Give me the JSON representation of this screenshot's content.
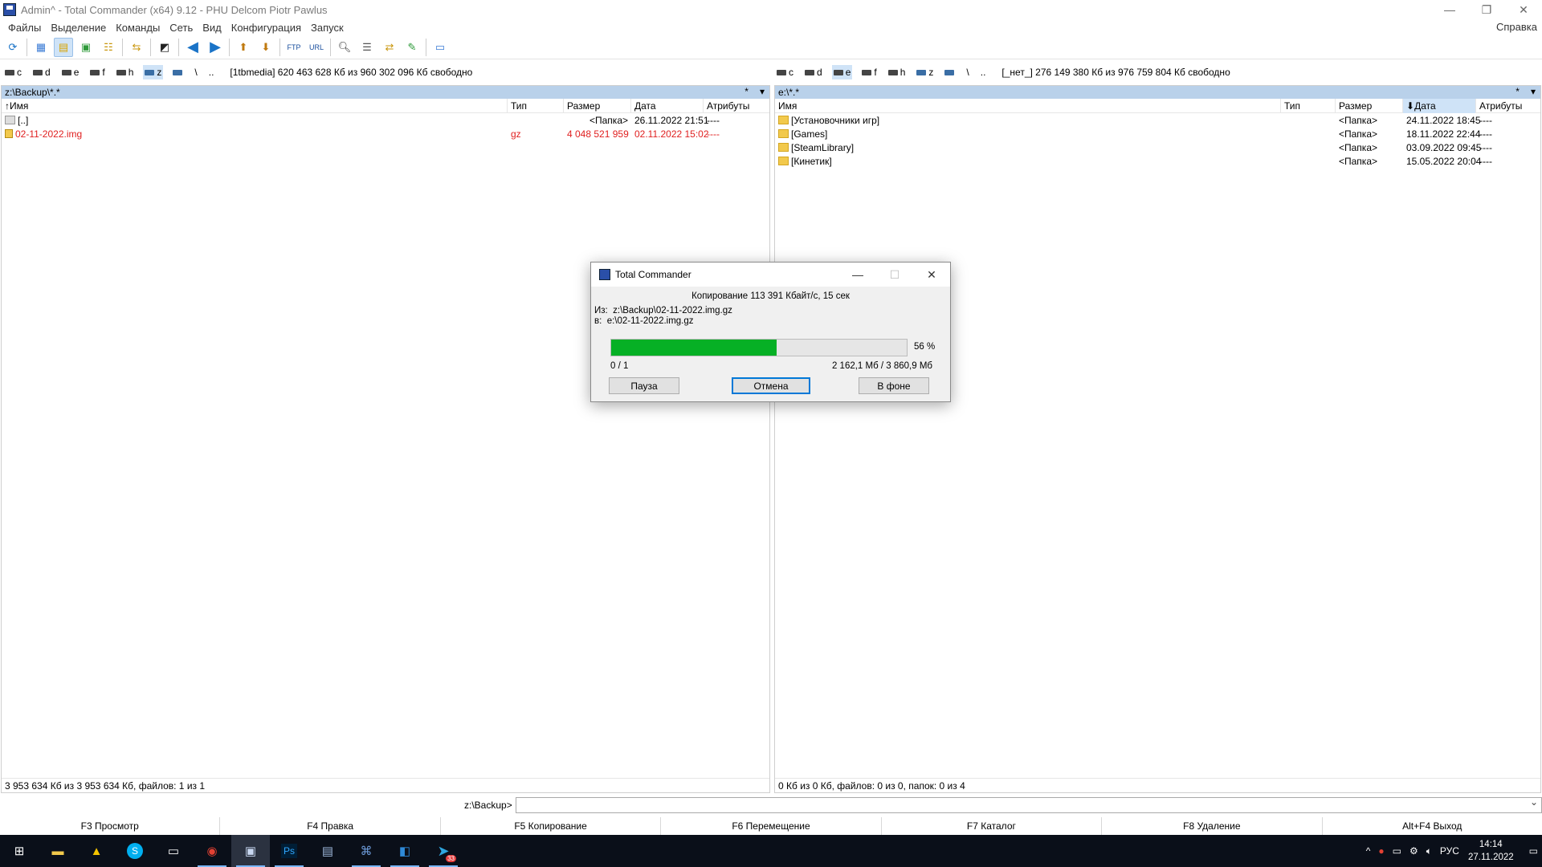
{
  "window": {
    "title": "Admin^ - Total Commander (x64) 9.12 - PHU Delcom Piotr Pawlus",
    "controls": [
      "—",
      "❐",
      "✕"
    ]
  },
  "menu": {
    "items": [
      "Файлы",
      "Выделение",
      "Команды",
      "Сеть",
      "Вид",
      "Конфигурация",
      "Запуск"
    ],
    "help": "Справка"
  },
  "toolbar": {
    "buttons": [
      "refresh-icon",
      "brief-view-icon",
      "tree-view-icon",
      "thumbnails-icon",
      "tree-panel-icon",
      "compare-dirs-icon",
      "invert-icon",
      "back-icon",
      "forward-icon",
      "pack-icon",
      "unpack-icon",
      "ftp-icon",
      "url-icon",
      "search-icon",
      "multi-rename-icon",
      "sync-dirs-icon",
      "notepad-icon",
      "copy-names-icon"
    ],
    "ftp_label": "FTP",
    "url_label": "URL"
  },
  "left": {
    "drives": [
      "c",
      "d",
      "e",
      "f",
      "h",
      "z"
    ],
    "active_drive": "z",
    "nav_root": "\\",
    "nav_up": "..",
    "drive_info": "[1tbmedia]  620 463 628 Кб из 960 302 096 Кб свободно",
    "path": "z:\\Backup\\*.*",
    "path_star": "*",
    "path_arrow": "▾",
    "columns": [
      "Имя",
      "Тип",
      "Размер",
      "Дата",
      "Атрибуты"
    ],
    "rows": [
      {
        "name": "[..]",
        "type": "",
        "size": "<Папка>",
        "date": "26.11.2022 21:51",
        "attr": "----",
        "icon": "up-dir-icon"
      },
      {
        "name": "02-11-2022.img",
        "type": "gz",
        "size": "4 048 521 959",
        "date": "02.11.2022 15:02",
        "attr": "----",
        "icon": "archive-icon"
      }
    ],
    "status": "3 953 634 Кб из 3 953 634 Кб, файлов: 1 из 1"
  },
  "right": {
    "drives": [
      "c",
      "d",
      "e",
      "f",
      "h",
      "z"
    ],
    "active_drive": "e",
    "nav_root": "\\",
    "nav_up": "..",
    "drive_info": "[_нет_]  276 149 380 Кб из 976 759 804 Кб свободно",
    "path": "e:\\*.*",
    "path_star": "*",
    "path_arrow": "▾",
    "columns": [
      "Имя",
      "Тип",
      "Размер",
      "Дата",
      "Атрибуты"
    ],
    "rows": [
      {
        "name": "[Установочники игр]",
        "type": "",
        "size": "<Папка>",
        "date": "24.11.2022 18:45",
        "attr": "----"
      },
      {
        "name": "[Games]",
        "type": "",
        "size": "<Папка>",
        "date": "18.11.2022 22:44",
        "attr": "----"
      },
      {
        "name": "[SteamLibrary]",
        "type": "",
        "size": "<Папка>",
        "date": "03.09.2022 09:45",
        "attr": "----"
      },
      {
        "name": "[Кинетик]",
        "type": "",
        "size": "<Папка>",
        "date": "15.05.2022 20:04",
        "attr": "----"
      }
    ],
    "status": "0 Кб из 0 Кб, файлов: 0 из 0, папок: 0 из 4"
  },
  "cmdline": {
    "prompt": "z:\\Backup>",
    "value": ""
  },
  "fkeys": [
    "F3 Просмотр",
    "F4 Правка",
    "F5 Копирование",
    "F6 Перемещение",
    "F7 Каталог",
    "F8 Удаление",
    "Alt+F4 Выход"
  ],
  "dialog": {
    "title": "Total Commander",
    "speed": "Копирование 113 391 Кбайт/с, 15 сек",
    "from_label": "Из:",
    "from_path": "z:\\Backup\\02-11-2022.img.gz",
    "to_label": "в:",
    "to_path": "e:\\02-11-2022.img.gz",
    "progress": 0.56,
    "percent_label": "56 %",
    "counts": "0 / 1",
    "sizes": "2 162,1 Мб / 3 860,9 Мб",
    "buttons": {
      "pause": "Пауза",
      "cancel": "Отмена",
      "background": "В фоне"
    },
    "accent": "#06b025"
  },
  "taskbar": {
    "apps": [
      "windows-start-icon",
      "file-explorer-icon",
      "norton-icon",
      "skype-icon",
      "terminal-icon",
      "chrome-icon",
      "total-commander-icon",
      "photoshop-icon",
      "network-tool-icon",
      "remote-desktop-icon",
      "visual-studio-code-icon",
      "telegram-icon"
    ],
    "photoshop_label": "Ps",
    "skype_label": "S",
    "telegram_badge": "33",
    "language": "РУС",
    "time": "14:14",
    "date": "27.11.2022"
  }
}
